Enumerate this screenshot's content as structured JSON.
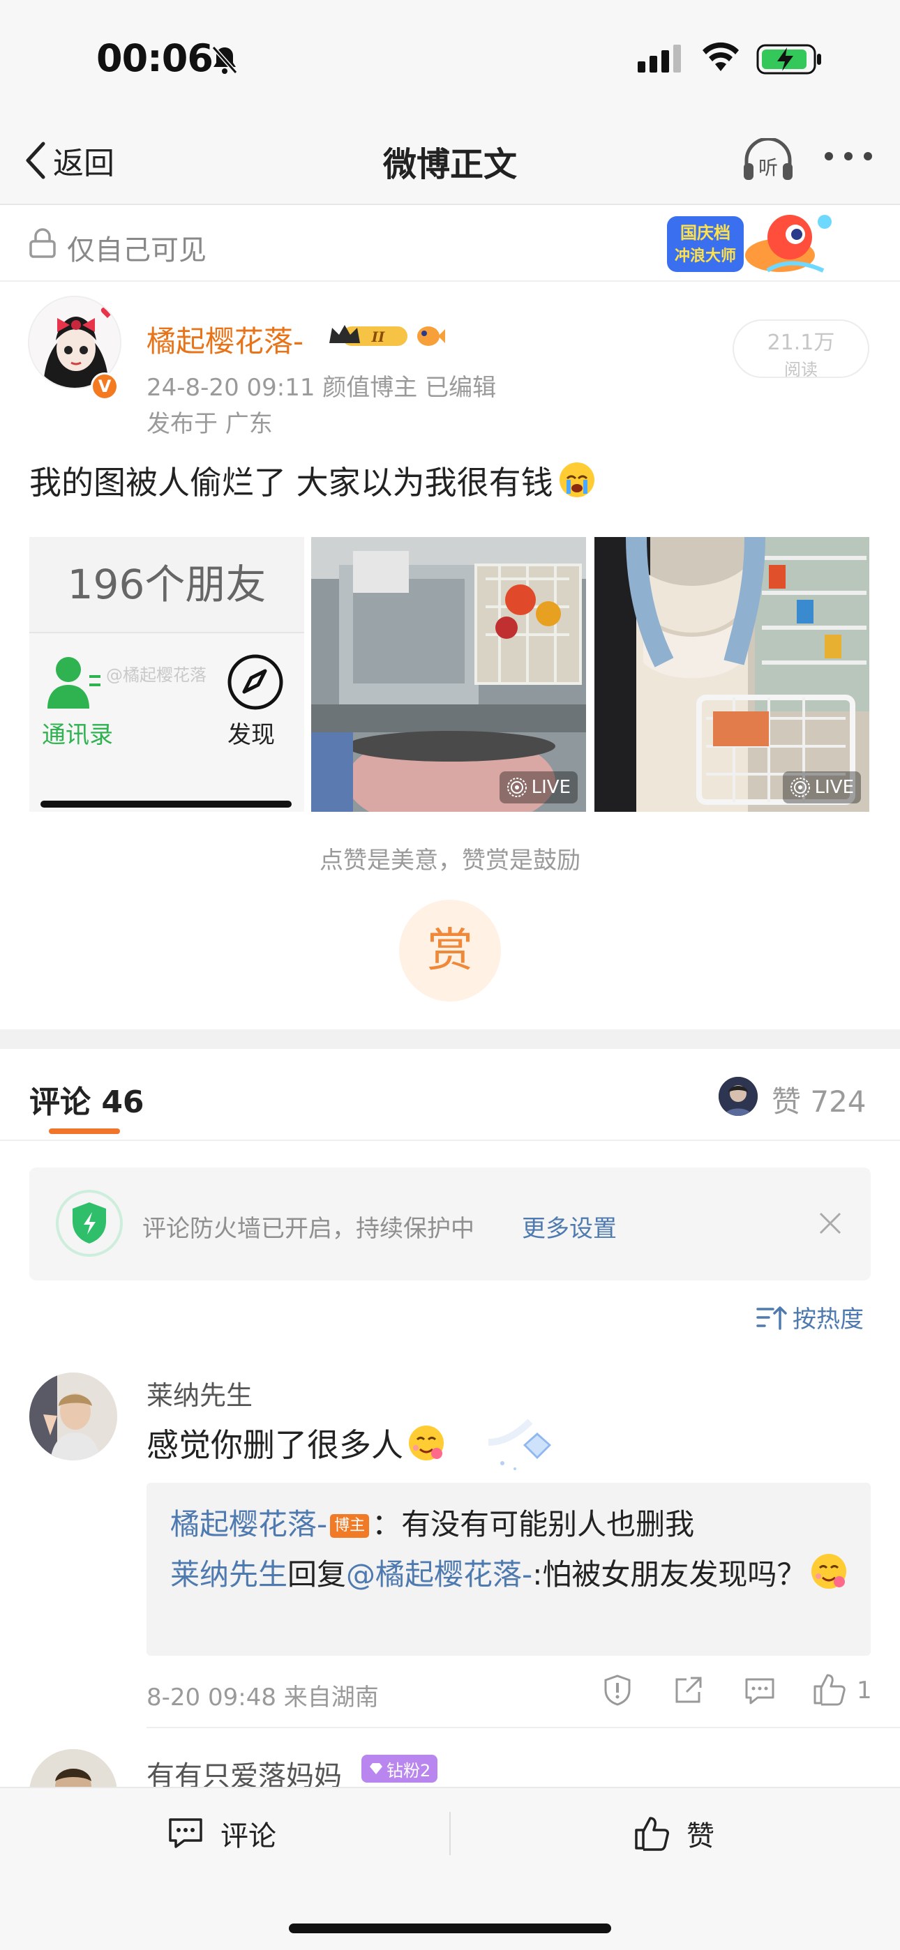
{
  "status": {
    "time": "00:06"
  },
  "nav": {
    "back_label": "返回",
    "title": "微博正文"
  },
  "post": {
    "visibility": "仅自己可见",
    "author": "橘起樱花落-",
    "meta": "24-8-20 09:11  颜值博主  已编辑",
    "location": "发布于 广东",
    "read_count": "21.1万",
    "read_label": "阅读",
    "text": "我的图被人偷烂了 大家以为我很有钱",
    "image1": {
      "friends_count": "196个朋友",
      "contacts_label": "通讯录",
      "discover_label": "发现",
      "watermark": "@橘起樱花落"
    },
    "live_label": "LIVE",
    "reward_text": "点赞是美意，赞赏是鼓励",
    "reward_glyph": "赏"
  },
  "tabs": {
    "comments": "评论 46",
    "likes": "赞 724"
  },
  "firewall": {
    "text": "评论防火墙已开启，持续保护中",
    "link": "更多设置"
  },
  "sort_label": "按热度",
  "comments": [
    {
      "user": "莱纳先生",
      "text": "感觉你删了很多人",
      "replies": [
        {
          "user": "橘起樱花落-",
          "tag": "博主",
          "text": "：有没有可能别人也删我"
        },
        {
          "user": "莱纳先生",
          "verb": "回复",
          "mention": "@橘起樱花落-",
          "text": ":怕被女朋友发现吗？"
        }
      ],
      "time": "8-20 09:48  来自湖南",
      "likes": "1"
    },
    {
      "user": "有有只爱落妈妈",
      "badge": "钻粉2"
    }
  ],
  "bottom": {
    "comment_label": "评论",
    "like_label": "赞"
  },
  "colors": {
    "accent_orange": "#f0742a",
    "link_blue": "#4f7ab0",
    "wechat_green": "#2fb250"
  }
}
